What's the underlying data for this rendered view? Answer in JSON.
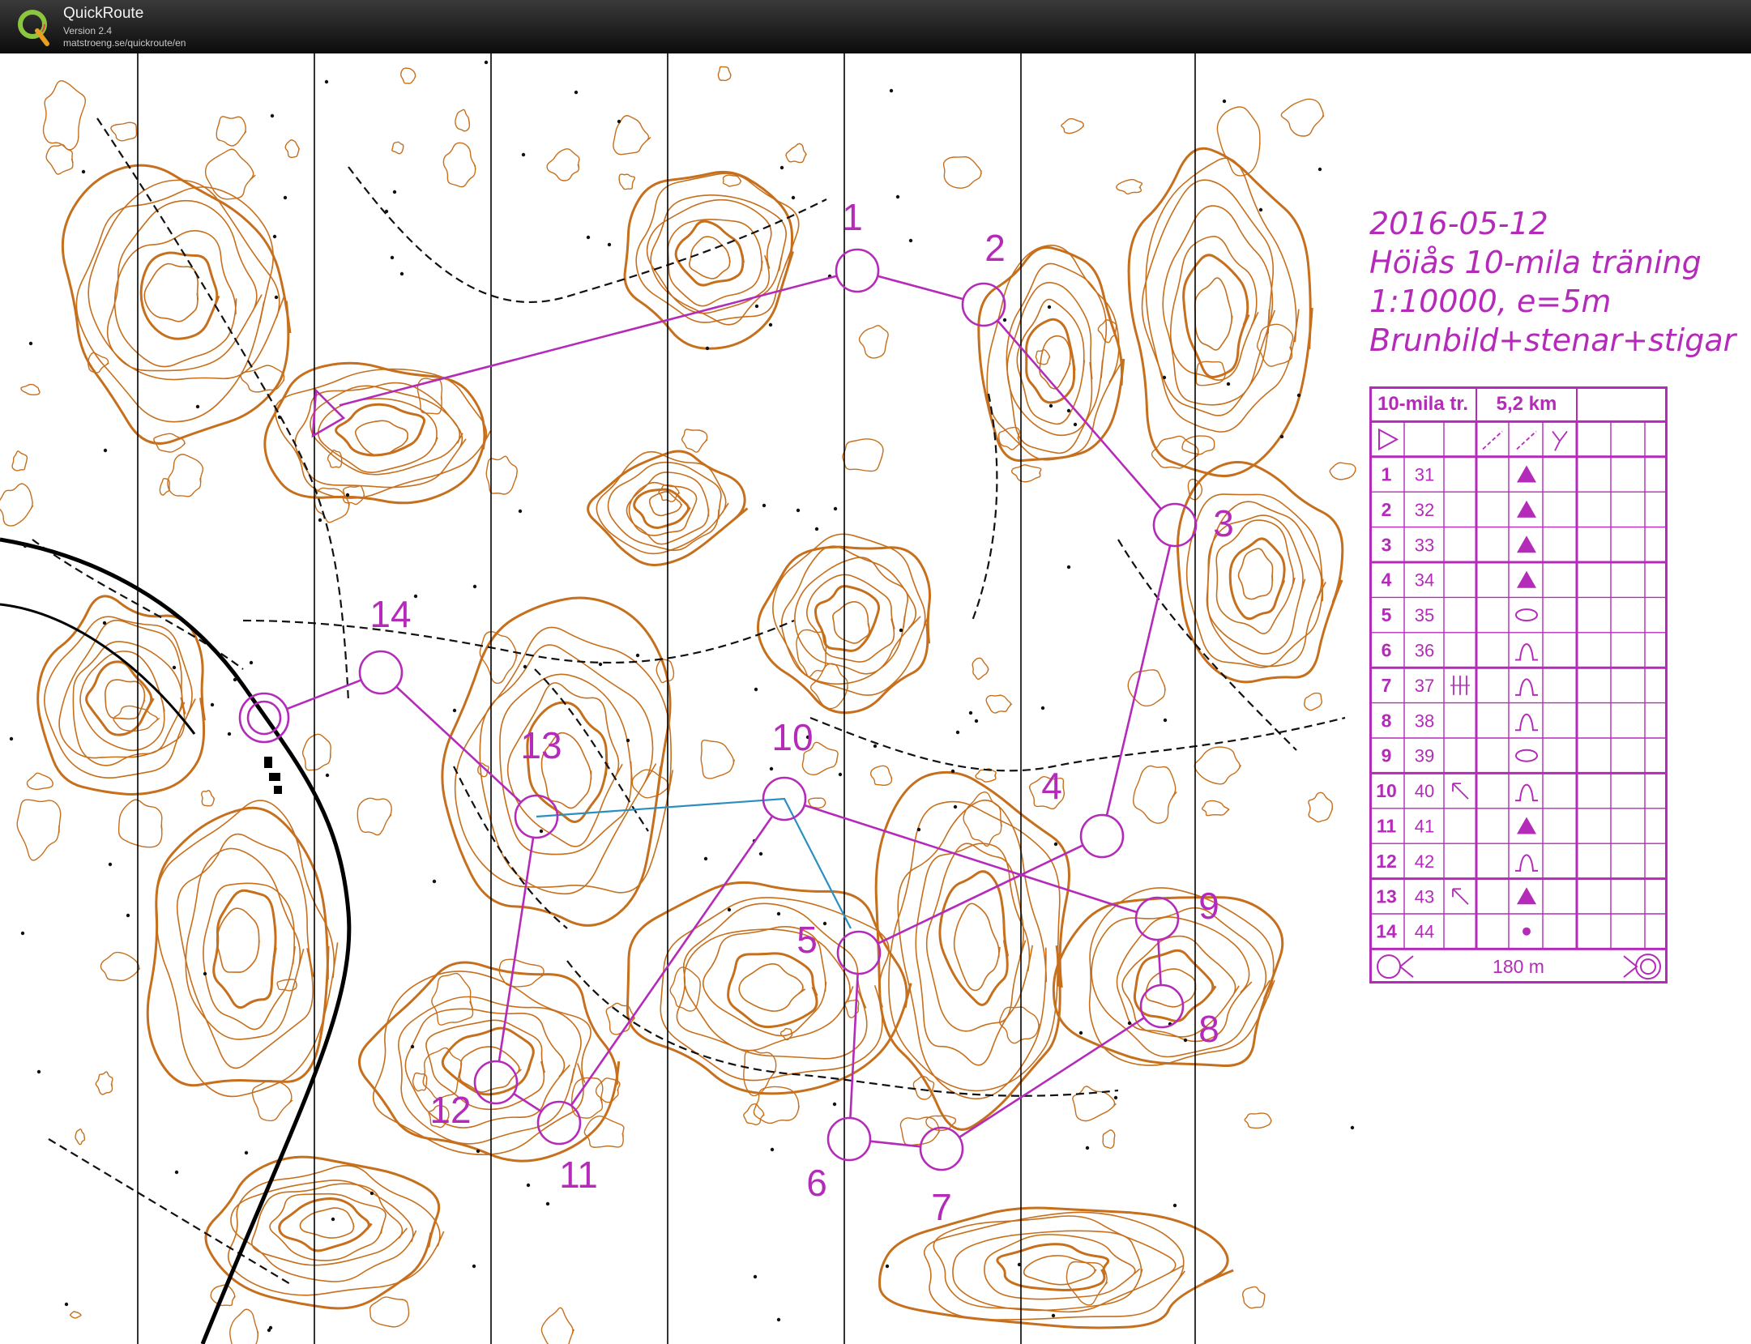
{
  "app": {
    "name": "QuickRoute",
    "version": "Version 2.4",
    "url": "matstroeng.se/quickroute/en"
  },
  "map_header": {
    "date": "2016-05-12",
    "event": "Höiås 10-mila träning",
    "scale": "1:10000,  e=5m",
    "map_type": "Brunbild+stenar+stigar"
  },
  "colors": {
    "overprint": "#b42bb9",
    "contour": "#c66f1c",
    "route": "#2a8fc0",
    "paths": "#111111"
  },
  "course": {
    "name": "10-mila tr.",
    "length": "5,2 km",
    "finish_distance": "180 m",
    "controls": [
      {
        "num": "1",
        "code": "31",
        "feature": "triangle-icon",
        "extra": ""
      },
      {
        "num": "2",
        "code": "32",
        "feature": "triangle-icon",
        "extra": ""
      },
      {
        "num": "3",
        "code": "33",
        "feature": "triangle-icon",
        "extra": ""
      },
      {
        "num": "4",
        "code": "34",
        "feature": "triangle-icon",
        "extra": ""
      },
      {
        "num": "5",
        "code": "35",
        "feature": "ellipse-icon",
        "extra": ""
      },
      {
        "num": "6",
        "code": "36",
        "feature": "knoll-icon",
        "extra": ""
      },
      {
        "num": "7",
        "code": "37",
        "feature": "knoll-icon",
        "extra": "lines-icon"
      },
      {
        "num": "8",
        "code": "38",
        "feature": "knoll-icon",
        "extra": ""
      },
      {
        "num": "9",
        "code": "39",
        "feature": "ellipse-icon",
        "extra": ""
      },
      {
        "num": "10",
        "code": "40",
        "feature": "knoll-icon",
        "extra": "arrow-nw-icon"
      },
      {
        "num": "11",
        "code": "41",
        "feature": "triangle-icon",
        "extra": ""
      },
      {
        "num": "12",
        "code": "42",
        "feature": "knoll-icon",
        "extra": ""
      },
      {
        "num": "13",
        "code": "43",
        "feature": "triangle-icon",
        "extra": "arrow-nw-icon"
      },
      {
        "num": "14",
        "code": "44",
        "feature": "dot-icon",
        "extra": ""
      }
    ]
  },
  "map_labels": [
    "1",
    "2",
    "3",
    "4",
    "5",
    "6",
    "7",
    "8",
    "9",
    "10",
    "11",
    "12",
    "13",
    "14"
  ]
}
